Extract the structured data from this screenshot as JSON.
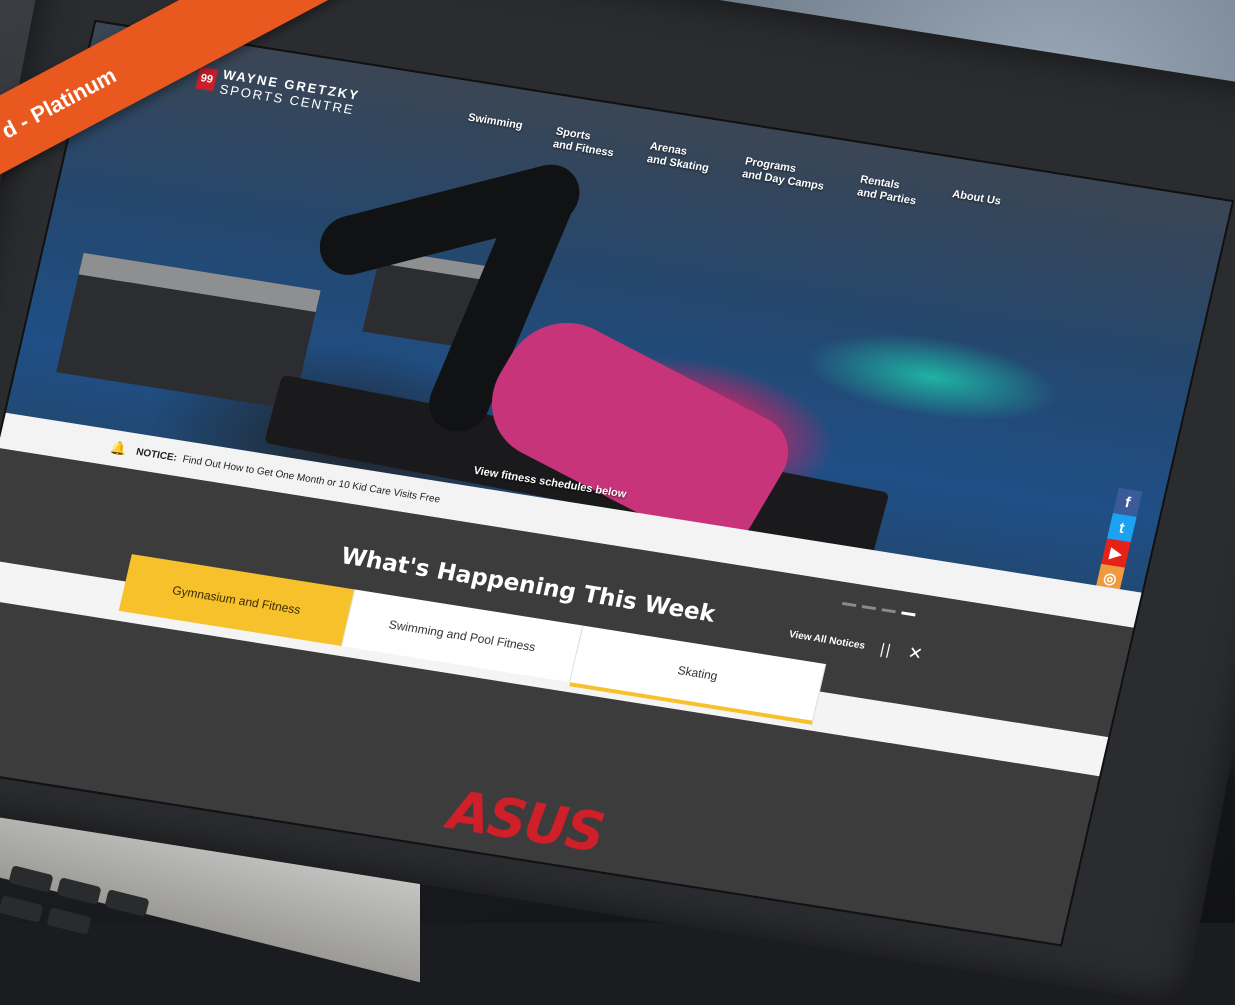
{
  "ribbon": {
    "text": "d - Platinum"
  },
  "site": {
    "logo_number": "99",
    "logo_line1": "WAYNE GRETZKY",
    "logo_line2": "SPORTS CENTRE"
  },
  "nav": {
    "items": [
      {
        "label": "Swimming"
      },
      {
        "label": "Sports\nand Fitness"
      },
      {
        "label": "Arenas\nand Skating"
      },
      {
        "label": "Programs\nand Day Camps"
      },
      {
        "label": "Rentals\nand Parties"
      },
      {
        "label": "About Us"
      }
    ]
  },
  "social": {
    "facebook": "f",
    "twitter": "t",
    "youtube": "▶",
    "instagram": "◎"
  },
  "notice": {
    "label": "NOTICE:",
    "text": "Find Out How to Get One Month or 10 Kid Care Visits Free"
  },
  "hero": {
    "caption": "View fitness schedules below"
  },
  "happening": {
    "title": "What's Happening This Week",
    "view_all": "View All Notices",
    "pause": "||",
    "close": "✕"
  },
  "tabs": [
    {
      "label": "Gymnasium and Fitness",
      "active": true
    },
    {
      "label": "Swimming and Pool Fitness",
      "active": false
    },
    {
      "label": "Skating",
      "active": false
    }
  ],
  "laptop": {
    "brand": "ASUS"
  },
  "colors": {
    "accent_yellow": "#f7c12b",
    "ribbon_orange": "#e8581f",
    "logo_red": "#c8202b"
  }
}
